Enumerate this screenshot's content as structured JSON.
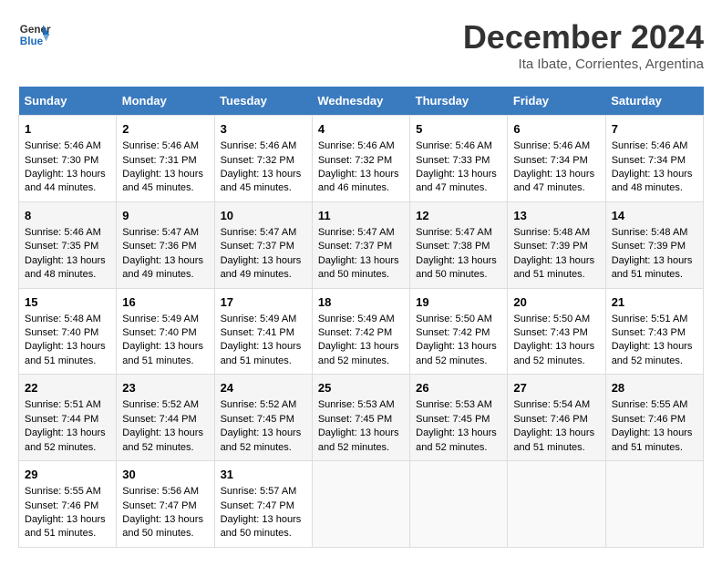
{
  "header": {
    "logo_line1": "General",
    "logo_line2": "Blue",
    "title": "December 2024",
    "subtitle": "Ita Ibate, Corrientes, Argentina"
  },
  "days_of_week": [
    "Sunday",
    "Monday",
    "Tuesday",
    "Wednesday",
    "Thursday",
    "Friday",
    "Saturday"
  ],
  "weeks": [
    [
      {
        "day": "1",
        "sunrise": "Sunrise: 5:46 AM",
        "sunset": "Sunset: 7:30 PM",
        "daylight": "Daylight: 13 hours and 44 minutes."
      },
      {
        "day": "2",
        "sunrise": "Sunrise: 5:46 AM",
        "sunset": "Sunset: 7:31 PM",
        "daylight": "Daylight: 13 hours and 45 minutes."
      },
      {
        "day": "3",
        "sunrise": "Sunrise: 5:46 AM",
        "sunset": "Sunset: 7:32 PM",
        "daylight": "Daylight: 13 hours and 45 minutes."
      },
      {
        "day": "4",
        "sunrise": "Sunrise: 5:46 AM",
        "sunset": "Sunset: 7:32 PM",
        "daylight": "Daylight: 13 hours and 46 minutes."
      },
      {
        "day": "5",
        "sunrise": "Sunrise: 5:46 AM",
        "sunset": "Sunset: 7:33 PM",
        "daylight": "Daylight: 13 hours and 47 minutes."
      },
      {
        "day": "6",
        "sunrise": "Sunrise: 5:46 AM",
        "sunset": "Sunset: 7:34 PM",
        "daylight": "Daylight: 13 hours and 47 minutes."
      },
      {
        "day": "7",
        "sunrise": "Sunrise: 5:46 AM",
        "sunset": "Sunset: 7:34 PM",
        "daylight": "Daylight: 13 hours and 48 minutes."
      }
    ],
    [
      {
        "day": "8",
        "sunrise": "Sunrise: 5:46 AM",
        "sunset": "Sunset: 7:35 PM",
        "daylight": "Daylight: 13 hours and 48 minutes."
      },
      {
        "day": "9",
        "sunrise": "Sunrise: 5:47 AM",
        "sunset": "Sunset: 7:36 PM",
        "daylight": "Daylight: 13 hours and 49 minutes."
      },
      {
        "day": "10",
        "sunrise": "Sunrise: 5:47 AM",
        "sunset": "Sunset: 7:37 PM",
        "daylight": "Daylight: 13 hours and 49 minutes."
      },
      {
        "day": "11",
        "sunrise": "Sunrise: 5:47 AM",
        "sunset": "Sunset: 7:37 PM",
        "daylight": "Daylight: 13 hours and 50 minutes."
      },
      {
        "day": "12",
        "sunrise": "Sunrise: 5:47 AM",
        "sunset": "Sunset: 7:38 PM",
        "daylight": "Daylight: 13 hours and 50 minutes."
      },
      {
        "day": "13",
        "sunrise": "Sunrise: 5:48 AM",
        "sunset": "Sunset: 7:39 PM",
        "daylight": "Daylight: 13 hours and 51 minutes."
      },
      {
        "day": "14",
        "sunrise": "Sunrise: 5:48 AM",
        "sunset": "Sunset: 7:39 PM",
        "daylight": "Daylight: 13 hours and 51 minutes."
      }
    ],
    [
      {
        "day": "15",
        "sunrise": "Sunrise: 5:48 AM",
        "sunset": "Sunset: 7:40 PM",
        "daylight": "Daylight: 13 hours and 51 minutes."
      },
      {
        "day": "16",
        "sunrise": "Sunrise: 5:49 AM",
        "sunset": "Sunset: 7:40 PM",
        "daylight": "Daylight: 13 hours and 51 minutes."
      },
      {
        "day": "17",
        "sunrise": "Sunrise: 5:49 AM",
        "sunset": "Sunset: 7:41 PM",
        "daylight": "Daylight: 13 hours and 51 minutes."
      },
      {
        "day": "18",
        "sunrise": "Sunrise: 5:49 AM",
        "sunset": "Sunset: 7:42 PM",
        "daylight": "Daylight: 13 hours and 52 minutes."
      },
      {
        "day": "19",
        "sunrise": "Sunrise: 5:50 AM",
        "sunset": "Sunset: 7:42 PM",
        "daylight": "Daylight: 13 hours and 52 minutes."
      },
      {
        "day": "20",
        "sunrise": "Sunrise: 5:50 AM",
        "sunset": "Sunset: 7:43 PM",
        "daylight": "Daylight: 13 hours and 52 minutes."
      },
      {
        "day": "21",
        "sunrise": "Sunrise: 5:51 AM",
        "sunset": "Sunset: 7:43 PM",
        "daylight": "Daylight: 13 hours and 52 minutes."
      }
    ],
    [
      {
        "day": "22",
        "sunrise": "Sunrise: 5:51 AM",
        "sunset": "Sunset: 7:44 PM",
        "daylight": "Daylight: 13 hours and 52 minutes."
      },
      {
        "day": "23",
        "sunrise": "Sunrise: 5:52 AM",
        "sunset": "Sunset: 7:44 PM",
        "daylight": "Daylight: 13 hours and 52 minutes."
      },
      {
        "day": "24",
        "sunrise": "Sunrise: 5:52 AM",
        "sunset": "Sunset: 7:45 PM",
        "daylight": "Daylight: 13 hours and 52 minutes."
      },
      {
        "day": "25",
        "sunrise": "Sunrise: 5:53 AM",
        "sunset": "Sunset: 7:45 PM",
        "daylight": "Daylight: 13 hours and 52 minutes."
      },
      {
        "day": "26",
        "sunrise": "Sunrise: 5:53 AM",
        "sunset": "Sunset: 7:45 PM",
        "daylight": "Daylight: 13 hours and 52 minutes."
      },
      {
        "day": "27",
        "sunrise": "Sunrise: 5:54 AM",
        "sunset": "Sunset: 7:46 PM",
        "daylight": "Daylight: 13 hours and 51 minutes."
      },
      {
        "day": "28",
        "sunrise": "Sunrise: 5:55 AM",
        "sunset": "Sunset: 7:46 PM",
        "daylight": "Daylight: 13 hours and 51 minutes."
      }
    ],
    [
      {
        "day": "29",
        "sunrise": "Sunrise: 5:55 AM",
        "sunset": "Sunset: 7:46 PM",
        "daylight": "Daylight: 13 hours and 51 minutes."
      },
      {
        "day": "30",
        "sunrise": "Sunrise: 5:56 AM",
        "sunset": "Sunset: 7:47 PM",
        "daylight": "Daylight: 13 hours and 50 minutes."
      },
      {
        "day": "31",
        "sunrise": "Sunrise: 5:57 AM",
        "sunset": "Sunset: 7:47 PM",
        "daylight": "Daylight: 13 hours and 50 minutes."
      },
      null,
      null,
      null,
      null
    ]
  ]
}
